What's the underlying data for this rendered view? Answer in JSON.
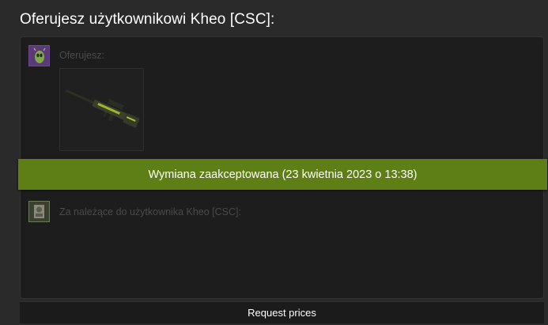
{
  "offer": {
    "title": "Oferujesz użytkownikowi Kheo [CSC]:"
  },
  "you_offer": {
    "label": "Oferujesz:",
    "avatar_icon": "alien-avatar-icon",
    "items": [
      {
        "icon": "sniper-rifle-icon"
      }
    ]
  },
  "status": {
    "text": "Wymiana zaakceptowana (23 kwietnia 2023 o 13:38)",
    "color": "#5d7f15"
  },
  "they_offer": {
    "label": "Za należące do użytkownika Kheo [CSC]:",
    "avatar_icon": "user-avatar-icon"
  },
  "actions": {
    "request_prices": "Request prices"
  }
}
